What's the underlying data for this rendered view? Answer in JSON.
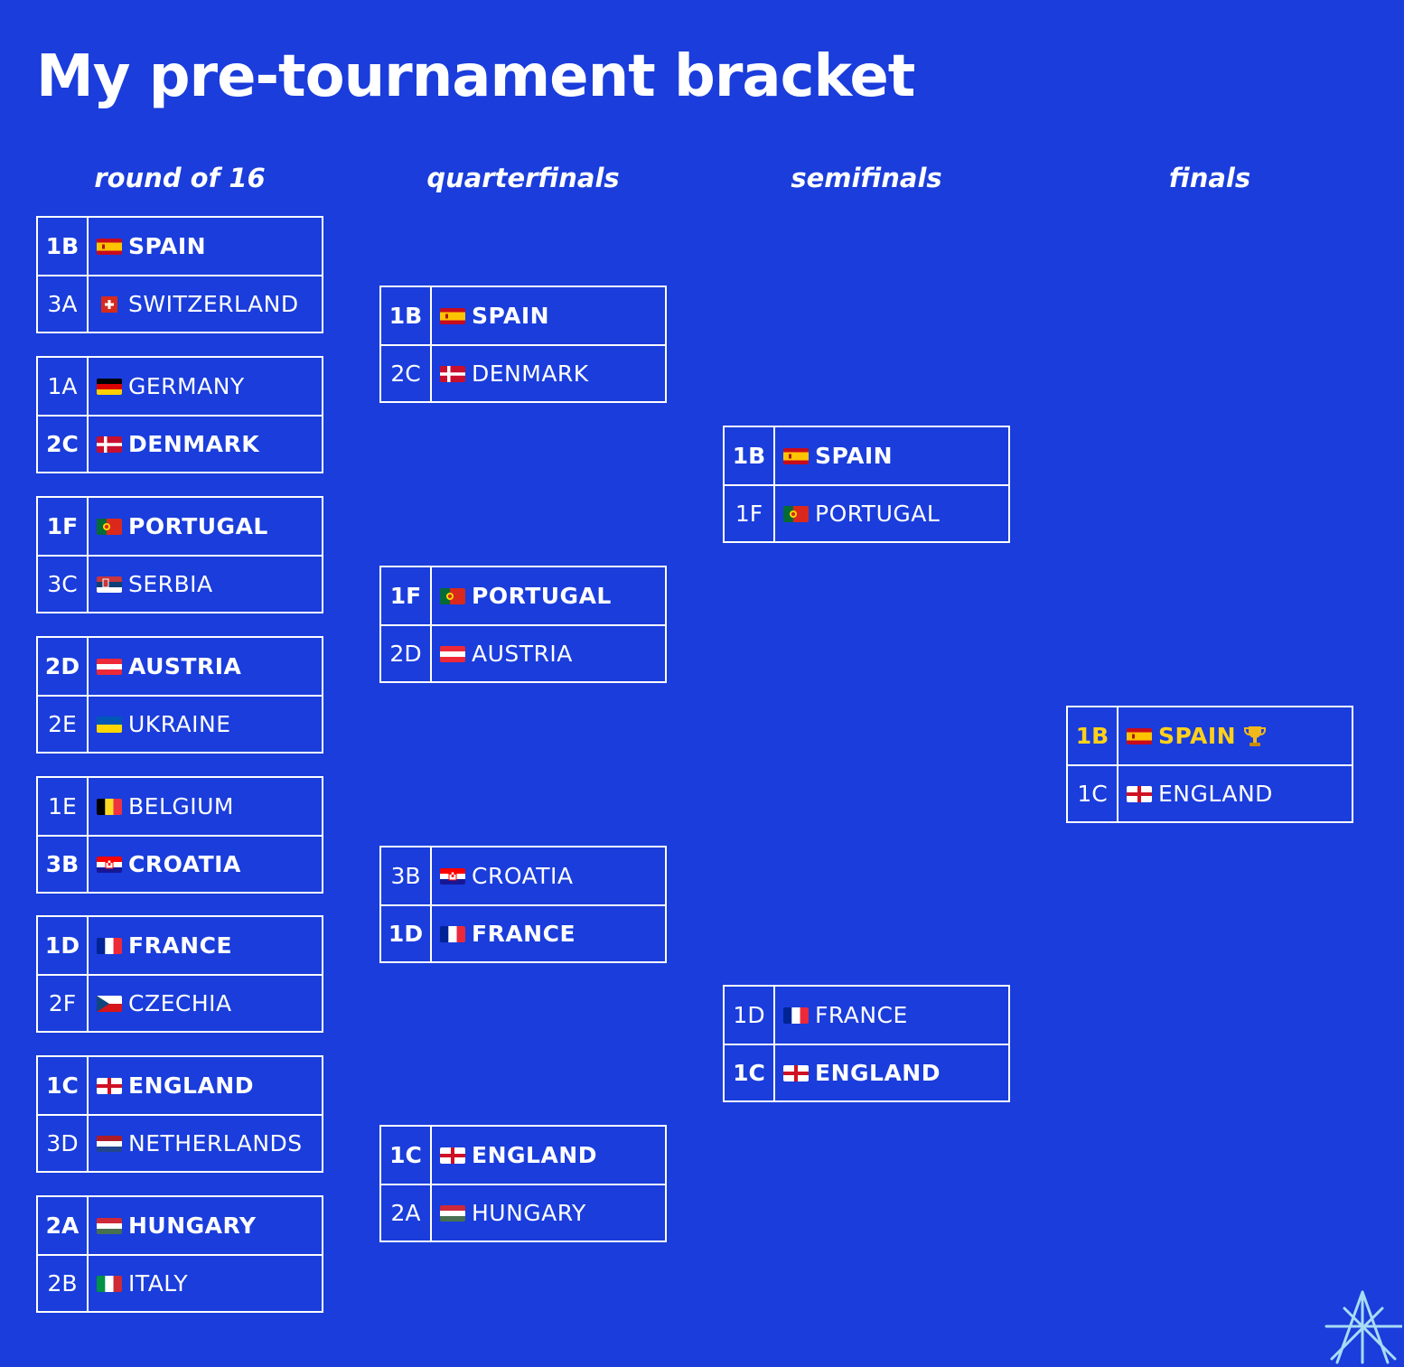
{
  "title": "My pre-tournament bracket",
  "rounds": [
    "round of 16",
    "quarterfinals",
    "semifinals",
    "finals"
  ],
  "flags": {
    "spain": "spain-flag",
    "switzerland": "switzerland-flag",
    "germany": "germany-flag",
    "denmark": "denmark-flag",
    "portugal": "portugal-flag",
    "serbia": "serbia-flag",
    "austria": "austria-flag",
    "ukraine": "ukraine-flag",
    "belgium": "belgium-flag",
    "croatia": "croatia-flag",
    "france": "france-flag",
    "czechia": "czechia-flag",
    "england": "england-flag",
    "netherlands": "netherlands-flag",
    "hungary": "hungary-flag",
    "italy": "italy-flag"
  },
  "round_of_16": [
    {
      "teams": [
        {
          "seed": "1B",
          "name": "SPAIN",
          "winner": true
        },
        {
          "seed": "3A",
          "name": "SWITZERLAND",
          "winner": false
        }
      ]
    },
    {
      "teams": [
        {
          "seed": "1A",
          "name": "GERMANY",
          "winner": false
        },
        {
          "seed": "2C",
          "name": "DENMARK",
          "winner": true
        }
      ]
    },
    {
      "teams": [
        {
          "seed": "1F",
          "name": "PORTUGAL",
          "winner": true
        },
        {
          "seed": "3C",
          "name": "SERBIA",
          "winner": false
        }
      ]
    },
    {
      "teams": [
        {
          "seed": "2D",
          "name": "AUSTRIA",
          "winner": true
        },
        {
          "seed": "2E",
          "name": "UKRAINE",
          "winner": false
        }
      ]
    },
    {
      "teams": [
        {
          "seed": "1E",
          "name": "BELGIUM",
          "winner": false
        },
        {
          "seed": "3B",
          "name": "CROATIA",
          "winner": true
        }
      ]
    },
    {
      "teams": [
        {
          "seed": "1D",
          "name": "FRANCE",
          "winner": true
        },
        {
          "seed": "2F",
          "name": "CZECHIA",
          "winner": false
        }
      ]
    },
    {
      "teams": [
        {
          "seed": "1C",
          "name": "ENGLAND",
          "winner": true
        },
        {
          "seed": "3D",
          "name": "NETHERLANDS",
          "winner": false
        }
      ]
    },
    {
      "teams": [
        {
          "seed": "2A",
          "name": "HUNGARY",
          "winner": true
        },
        {
          "seed": "2B",
          "name": "ITALY",
          "winner": false
        }
      ]
    }
  ],
  "quarterfinals": [
    {
      "teams": [
        {
          "seed": "1B",
          "name": "SPAIN",
          "winner": true
        },
        {
          "seed": "2C",
          "name": "DENMARK",
          "winner": false
        }
      ]
    },
    {
      "teams": [
        {
          "seed": "1F",
          "name": "PORTUGAL",
          "winner": true
        },
        {
          "seed": "2D",
          "name": "AUSTRIA",
          "winner": false
        }
      ]
    },
    {
      "teams": [
        {
          "seed": "3B",
          "name": "CROATIA",
          "winner": false
        },
        {
          "seed": "1D",
          "name": "FRANCE",
          "winner": true
        }
      ]
    },
    {
      "teams": [
        {
          "seed": "1C",
          "name": "ENGLAND",
          "winner": true
        },
        {
          "seed": "2A",
          "name": "HUNGARY",
          "winner": false
        }
      ]
    }
  ],
  "semifinals": [
    {
      "teams": [
        {
          "seed": "1B",
          "name": "SPAIN",
          "winner": true
        },
        {
          "seed": "1F",
          "name": "PORTUGAL",
          "winner": false
        }
      ]
    },
    {
      "teams": [
        {
          "seed": "1D",
          "name": "FRANCE",
          "winner": false
        },
        {
          "seed": "1C",
          "name": "ENGLAND",
          "winner": true
        }
      ]
    }
  ],
  "finals": [
    {
      "teams": [
        {
          "seed": "1B",
          "name": "SPAIN",
          "winner": true,
          "champion": true
        },
        {
          "seed": "1C",
          "name": "ENGLAND",
          "winner": false
        }
      ]
    }
  ],
  "champion_icon": "trophy-icon",
  "colors": {
    "background": "#1a3ddb",
    "lines": "#ffffff",
    "champion": "#ffd11a",
    "logo": "#a8dcf5"
  }
}
